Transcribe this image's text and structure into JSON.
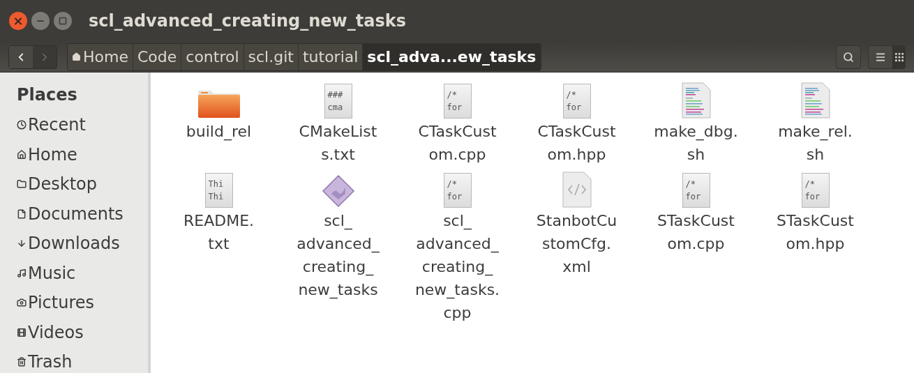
{
  "window": {
    "title": "scl_advanced_creating_new_tasks",
    "buttons": [
      {
        "kind": "close",
        "label": "×"
      },
      {
        "kind": "minimize"
      },
      {
        "kind": "maximize"
      }
    ]
  },
  "toolbar": {
    "nav": [
      {
        "kind": "back",
        "disabled": false
      },
      {
        "kind": "forward",
        "disabled": true
      }
    ],
    "path": [
      {
        "label": "Home",
        "home": true,
        "selected": false
      },
      {
        "label": "Code",
        "home": false,
        "selected": false
      },
      {
        "label": "control",
        "home": false,
        "selected": false
      },
      {
        "label": "scl.git",
        "home": false,
        "selected": false
      },
      {
        "label": "tutorial",
        "home": false,
        "selected": false
      },
      {
        "label": "scl_adva...ew_tasks",
        "home": false,
        "selected": true
      }
    ],
    "buttons": [
      {
        "kind": "search",
        "selected": false
      },
      {
        "kind": "list",
        "selected": false
      },
      {
        "kind": "grid",
        "selected": true
      }
    ]
  },
  "sidebar": {
    "heading": "Places",
    "items": [
      {
        "kind": "recent",
        "label": "Recent"
      },
      {
        "kind": "home",
        "label": "Home"
      },
      {
        "kind": "desktop",
        "label": "Desktop"
      },
      {
        "kind": "documents",
        "label": "Documents"
      },
      {
        "kind": "downloads",
        "label": "Downloads"
      },
      {
        "kind": "music",
        "label": "Music"
      },
      {
        "kind": "pictures",
        "label": "Pictures"
      },
      {
        "kind": "videos",
        "label": "Videos"
      },
      {
        "kind": "trash",
        "label": "Trash"
      }
    ]
  },
  "files": [
    {
      "kind": "folder",
      "lines": [
        "build_rel"
      ]
    },
    {
      "kind": "text",
      "preview": [
        "###",
        "cma"
      ],
      "lines": [
        "CMakeList",
        "s.txt"
      ]
    },
    {
      "kind": "text",
      "preview": [
        "/*",
        "for"
      ],
      "lines": [
        "CTaskCust",
        "om.cpp"
      ]
    },
    {
      "kind": "text",
      "preview": [
        "/*",
        "for"
      ],
      "lines": [
        "CTaskCust",
        "om.hpp"
      ]
    },
    {
      "kind": "script",
      "lines": [
        "make_dbg.",
        "sh"
      ]
    },
    {
      "kind": "script",
      "lines": [
        "make_rel.",
        "sh"
      ]
    },
    {
      "kind": "text",
      "preview": [
        "Thi",
        "Thi"
      ],
      "lines": [
        "README.",
        "txt"
      ]
    },
    {
      "kind": "executable",
      "lines": [
        "scl_",
        "advanced_",
        "creating_",
        "new_tasks"
      ]
    },
    {
      "kind": "text",
      "preview": [
        "/*",
        "for"
      ],
      "lines": [
        "scl_",
        "advanced_",
        "creating_",
        "new_tasks.",
        "cpp"
      ]
    },
    {
      "kind": "xml",
      "lines": [
        "StanbotCu",
        "stomCfg.",
        "xml"
      ]
    },
    {
      "kind": "text",
      "preview": [
        "/*",
        "for"
      ],
      "lines": [
        "STaskCust",
        "om.cpp"
      ]
    },
    {
      "kind": "text",
      "preview": [
        "/*",
        "for"
      ],
      "lines": [
        "STaskCust",
        "om.hpp"
      ]
    }
  ]
}
